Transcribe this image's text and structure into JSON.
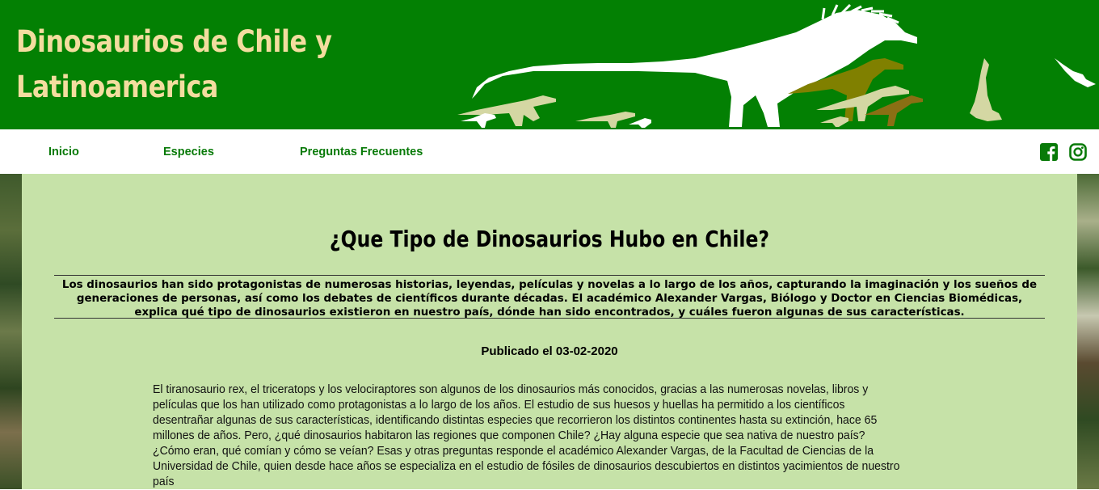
{
  "header": {
    "site_title_line1": "Dinosaurios de Chile y",
    "site_title_line2": "Latinoamerica",
    "banner_image": "dinosaur-silhouettes-banner",
    "colors": {
      "background": "#038003",
      "title": "#f3dd9f"
    }
  },
  "nav": {
    "items": [
      {
        "label": "Inicio"
      },
      {
        "label": "Especies"
      },
      {
        "label": "Preguntas Frecuentes"
      }
    ],
    "social": [
      {
        "icon": "facebook-icon"
      },
      {
        "icon": "instagram-icon"
      }
    ],
    "colors": {
      "link": "#087a08"
    }
  },
  "article": {
    "title": "¿Que Tipo de Dinosaurios Hubo en Chile?",
    "lead": "Los dinosaurios han sido protagonistas de numerosas historias, leyendas, películas y novelas a lo largo de los años, capturando la imaginación y los sueños de generaciones de personas, así como los debates de científicos durante décadas. El académico Alexander Vargas, Biólogo y Doctor en Ciencias Biomédicas, explica qué tipo de dinosaurios existieron en nuestro país, dónde han sido encontrados, y cuáles fueron algunas de sus características.",
    "published": "Publicado el 03-02-2020",
    "body": "El tiranosaurio rex, el triceratops y los velociraptores son algunos de los dinosaurios más conocidos, gracias a las numerosas novelas, libros y películas que los han utilizado como protagonistas a lo largo de los años. El estudio de sus huesos y huellas ha permitido a los científicos desentrañar algunas de sus características, identificando distintas especies que recorrieron los distintos continentes hasta su extinción, hace 65 millones de años. Pero, ¿qué dinosaurios habitaron las regiones que componen Chile? ¿Hay alguna especie que sea nativa de nuestro país? ¿Cómo eran, qué comían y cómo se veían? Esas y otras preguntas responde el académico Alexander Vargas, de la Facultad de Ciencias de la Universidad de Chile, quien desde hace años se especializa en el estudio de fósiles de dinosaurios descubiertos en distintos yacimientos de nuestro país",
    "colors": {
      "background": "#c6e2a8"
    }
  }
}
